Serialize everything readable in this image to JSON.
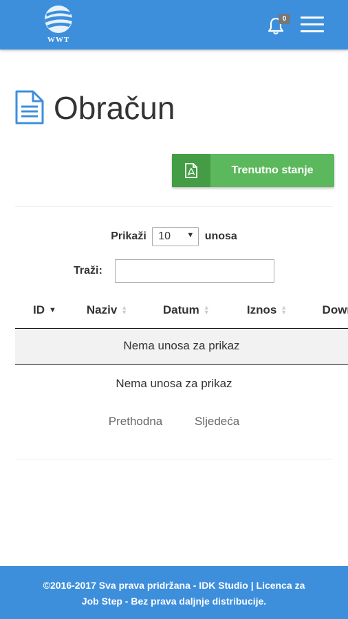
{
  "header": {
    "logo_text": "WWT",
    "notification_count": "0",
    "colors": {
      "bar": "#3d8fdc"
    },
    "icons": {
      "notifications": "bell-icon",
      "menu": "hamburger-menu-icon"
    }
  },
  "page": {
    "title": "Obračun",
    "title_icon": "document-icon",
    "report_button": {
      "label": "Trenutno stanje",
      "icon": "pdf-file-icon",
      "color": "#5cb85c"
    }
  },
  "table_controls": {
    "length_prefix": "Prikaži",
    "length_value": "10",
    "length_suffix": "unosa",
    "search_label": "Traži:",
    "search_value": ""
  },
  "table": {
    "columns": [
      "ID",
      "Naziv",
      "Datum",
      "Iznos",
      "Download"
    ],
    "sorted_column": "ID",
    "empty_message": "Nema unosa za prikaz"
  },
  "info_text": "Nema unosa za prikaz",
  "pagination": {
    "previous": "Prethodna",
    "next": "Sljedeća"
  },
  "footer": {
    "line1": "©2016-2017 Sva prava pridržana - IDK Studio | Licenca za",
    "line2": "Job Step - Bez prava daljnje distribucije."
  }
}
